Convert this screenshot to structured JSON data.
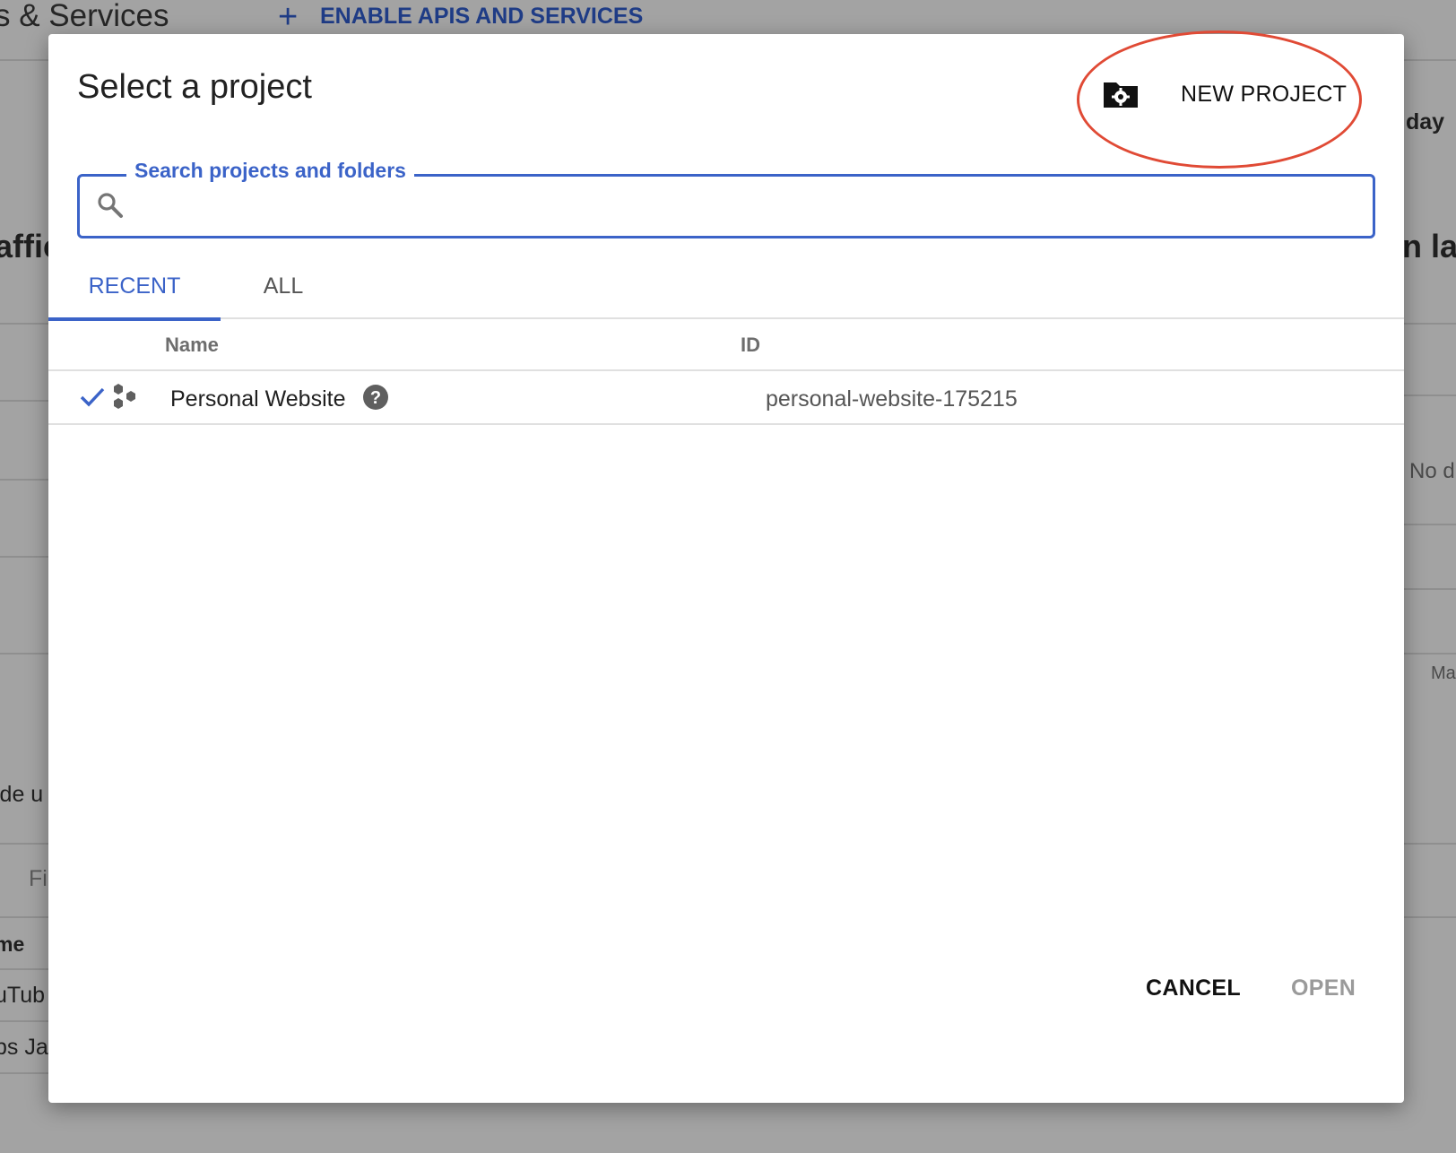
{
  "background": {
    "header_title": "s & Services",
    "enable_button_label": "ENABLE APIS AND SERVICES",
    "fragments": {
      "day": "day",
      "traffic": "affic",
      "right_large": "n la",
      "no_data": "No d",
      "ma": "Ma",
      "guide": "ide u",
      "filter": "Fi",
      "name": "me",
      "youtube": "uTub",
      "maps": "ps Ja"
    }
  },
  "dialog": {
    "title": "Select a project",
    "new_project_label": "NEW PROJECT",
    "search": {
      "label": "Search projects and folders",
      "value": ""
    },
    "tabs": [
      {
        "label": "RECENT",
        "active": true
      },
      {
        "label": "ALL",
        "active": false
      }
    ],
    "table": {
      "columns": [
        "Name",
        "ID"
      ],
      "rows": [
        {
          "name": "Personal Website",
          "id": "personal-website-175215",
          "selected": true
        }
      ]
    },
    "buttons": {
      "cancel": "CANCEL",
      "open": "OPEN"
    }
  },
  "colors": {
    "accent": "#3b63c8",
    "highlight": "#e04a35",
    "overlay": "#a3a3a3"
  },
  "icons": {
    "new_project": "folder-settings-icon",
    "search": "search-icon",
    "check": "check-icon",
    "project": "project-hexagons-icon",
    "help": "help-circle-icon",
    "plus": "plus-icon"
  }
}
